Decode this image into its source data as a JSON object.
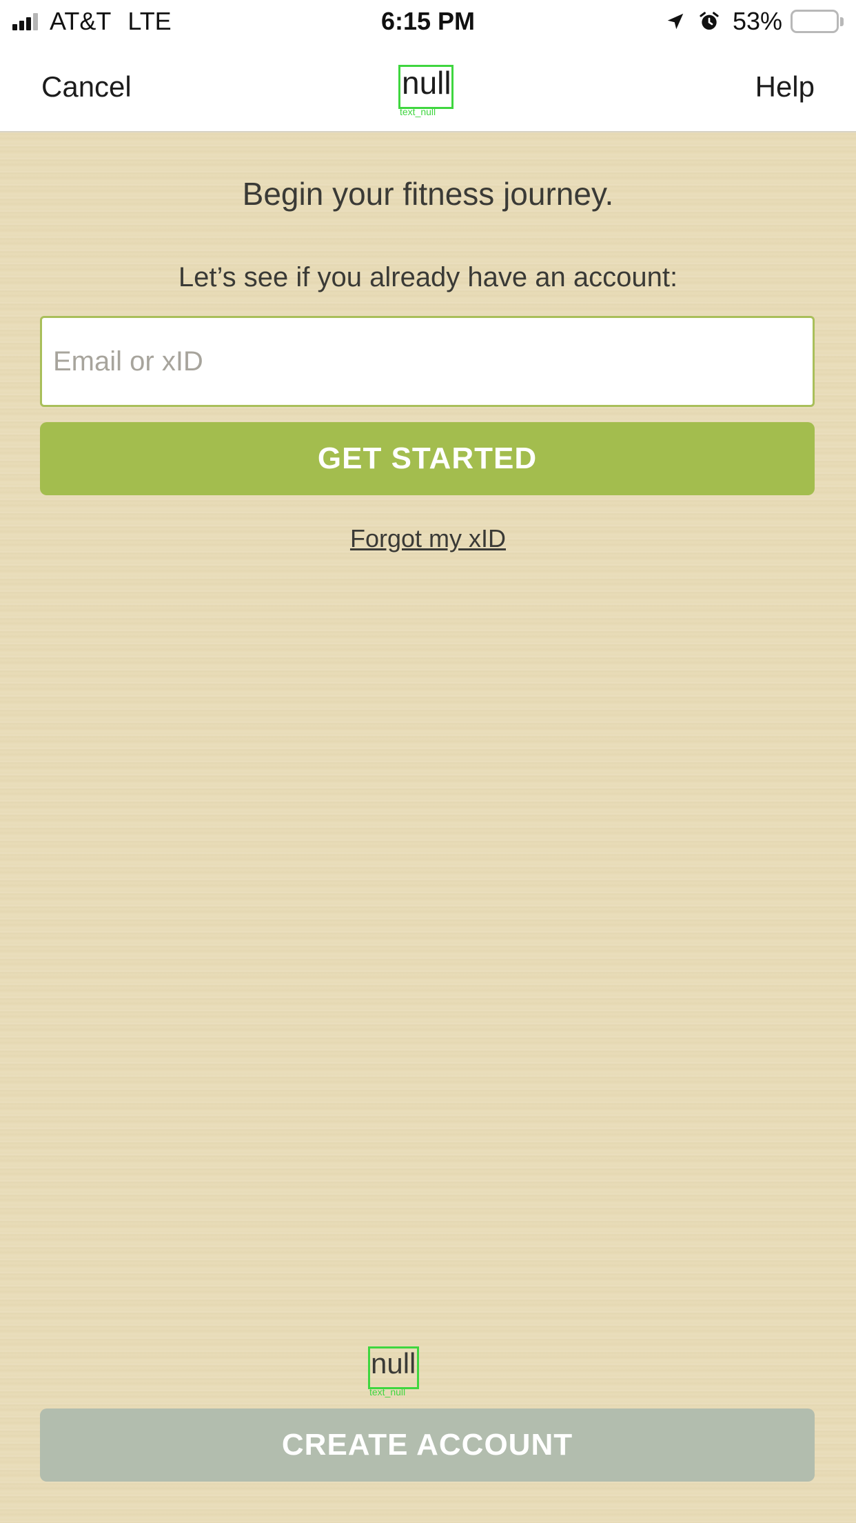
{
  "status_bar": {
    "carrier": "AT&T",
    "network": "LTE",
    "time": "6:15 PM",
    "battery_percent": "53%",
    "battery_level": 0.53,
    "signal_bars": 3,
    "icons": [
      "signal-icon",
      "location-arrow-icon",
      "alarm-clock-icon",
      "battery-icon"
    ]
  },
  "nav": {
    "cancel_label": "Cancel",
    "title": "null",
    "title_tag": "text_null",
    "help_label": "Help"
  },
  "main": {
    "headline": "Begin your fitness journey.",
    "subline": "Let’s see if you already have an account:",
    "email_placeholder": "Email or xID",
    "email_value": "",
    "get_started_label": "GET STARTED",
    "forgot_label": "Forgot my xID"
  },
  "footer": {
    "label": "null",
    "label_tag": "text_null",
    "create_account_label": "CREATE ACCOUNT"
  },
  "colors": {
    "accent_green": "#a3bd4e",
    "input_border": "#a9bf5a",
    "disabled_button": "#b2bdae",
    "background": "#e8dcb8"
  }
}
